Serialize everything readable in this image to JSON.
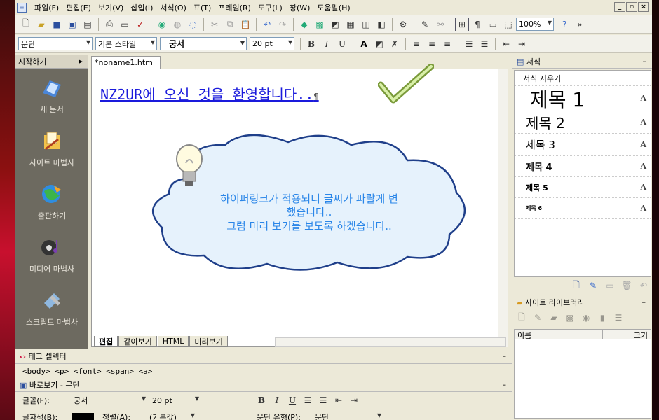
{
  "menu": [
    "파일(F)",
    "편집(E)",
    "보기(V)",
    "삽입(I)",
    "서식(O)",
    "표(T)",
    "프레임(R)",
    "도구(L)",
    "창(W)",
    "도움말(H)"
  ],
  "window_controls": [
    "_",
    "▫",
    "×"
  ],
  "toolbar2": {
    "paragraph": "문단",
    "style": "기본 스타일",
    "font": "궁서",
    "size": "20 pt",
    "zoom": "100%"
  },
  "left_panel": {
    "title": "시작하기",
    "items": [
      "새 문서",
      "사이트 마법사",
      "출판하기",
      "미디어 마법사",
      "스크립트 마법사"
    ]
  },
  "doc_tab": "*noname1.htm",
  "editor": {
    "heading": "NZ2UR에 오신 것을 환영합니다..",
    "pilcrow": "¶",
    "callout": [
      "하이퍼링크가 적용되니 글씨가 파랄게 변",
      "했습니다..",
      "그럼 미리 보기를 보도록 하겠습니다.."
    ]
  },
  "view_tabs": [
    "편집",
    "같이보기",
    "HTML",
    "미리보기"
  ],
  "tag_selector": {
    "title": "태그 셀렉터",
    "tags": "<body> <p> <font> <span> <a>"
  },
  "quick_view": {
    "title": "바로보기 - 문단",
    "font_label": "글꼴(F):",
    "font": "궁서",
    "size": "20 pt",
    "color_label": "글자색(B):",
    "align_label": "정렬(A):",
    "align": "(기본값)",
    "para_label": "문단 유형(P):",
    "para": "문단"
  },
  "styles_panel": {
    "title": "서식",
    "clear": "서식 지우기",
    "headings": [
      "제목 1",
      "제목 2",
      "제목 3",
      "제목 4",
      "제목 5",
      "제목 6"
    ],
    "a_glyph": "A"
  },
  "library": {
    "title": "사이트 라이브러리",
    "col_name": "이름",
    "col_size": "크기"
  }
}
